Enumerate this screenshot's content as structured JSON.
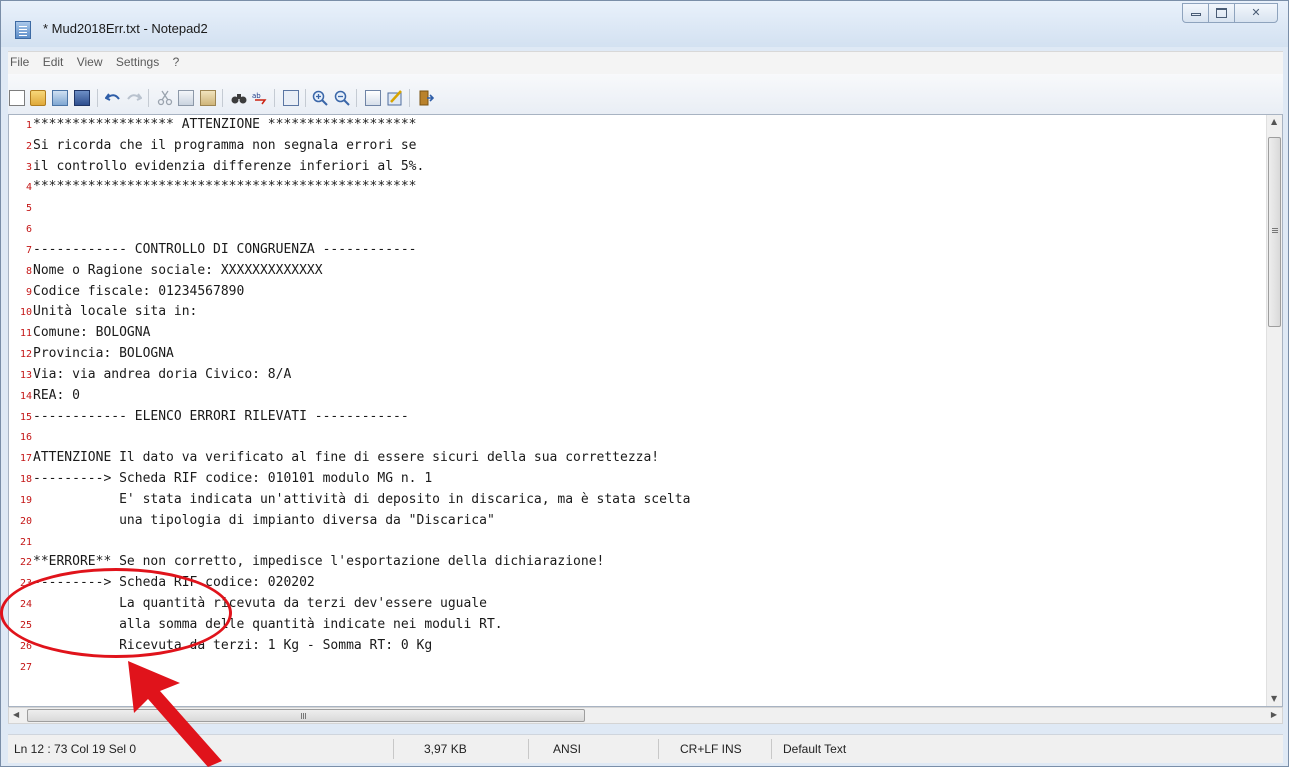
{
  "window": {
    "title": "* Mud2018Err.txt - Notepad2",
    "controls": {
      "minimize": "–",
      "maximize": "□",
      "close": "✕"
    }
  },
  "menu": [
    "File",
    "Edit",
    "View",
    "Settings",
    "?"
  ],
  "toolbar": {
    "icons": [
      "new-icon",
      "open-icon",
      "browse-icon",
      "save-icon",
      "undo-icon",
      "redo-icon",
      "cut-icon",
      "copy-icon",
      "paste-icon",
      "find-icon",
      "replace-icon",
      "wordwrap-icon",
      "zoom-in-icon",
      "zoom-out-icon",
      "scheme-icon",
      "customize-icon",
      "exit-icon"
    ]
  },
  "editor": {
    "lines": [
      {
        "n": "1",
        "text": "****************** ATTENZIONE *******************"
      },
      {
        "n": "2",
        "text": "Si ricorda che il programma non segnala errori se"
      },
      {
        "n": "3",
        "text": "il controllo evidenzia differenze inferiori al 5%."
      },
      {
        "n": "4",
        "text": "*************************************************"
      },
      {
        "n": "5",
        "text": ""
      },
      {
        "n": "6",
        "text": ""
      },
      {
        "n": "7",
        "text": "------------ CONTROLLO DI CONGRUENZA ------------"
      },
      {
        "n": "8",
        "text": "Nome o Ragione sociale: XXXXXXXXXXXXX"
      },
      {
        "n": "9",
        "text": "Codice fiscale: 01234567890"
      },
      {
        "n": "10",
        "text": "Unità locale sita in:"
      },
      {
        "n": "11",
        "text": "Comune: BOLOGNA"
      },
      {
        "n": "12",
        "text": "Provincia: BOLOGNA"
      },
      {
        "n": "13",
        "text": "Via: via andrea doria Civico: 8/A"
      },
      {
        "n": "14",
        "text": "REA: 0"
      },
      {
        "n": "15",
        "text": "------------ ELENCO ERRORI RILEVATI ------------"
      },
      {
        "n": "16",
        "text": ""
      },
      {
        "n": "17",
        "text": "ATTENZIONE Il dato va verificato al fine di essere sicuri della sua correttezza!"
      },
      {
        "n": "18",
        "text": "---------> Scheda RIF codice: 010101 modulo MG n. 1"
      },
      {
        "n": "19",
        "text": "           E' stata indicata un'attività di deposito in discarica, ma è stata scelta"
      },
      {
        "n": "20",
        "text": "           una tipologia di impianto diversa da \"Discarica\""
      },
      {
        "n": "21",
        "text": ""
      },
      {
        "n": "22",
        "text": "**ERRORE** Se non corretto, impedisce l'esportazione della dichiarazione!"
      },
      {
        "n": "23",
        "text": "---------> Scheda RIF codice: 020202"
      },
      {
        "n": "24",
        "text": "           La quantità ricevuta da terzi dev'essere uguale"
      },
      {
        "n": "25",
        "text": "           alla somma delle quantità indicate nei moduli RT."
      },
      {
        "n": "26",
        "text": "           Ricevuta da terzi: 1 Kg - Somma RT: 0 Kg"
      },
      {
        "n": "27",
        "text": ""
      }
    ]
  },
  "status": {
    "position": "Ln 12 : 73  Col 19  Sel 0",
    "size": "3,97 KB",
    "encoding": "ANSI",
    "eol_mode": "CR+LF  INS",
    "scheme": "Default Text"
  },
  "colors": {
    "line_number": "#c41616",
    "annotation": "#e0131b"
  }
}
